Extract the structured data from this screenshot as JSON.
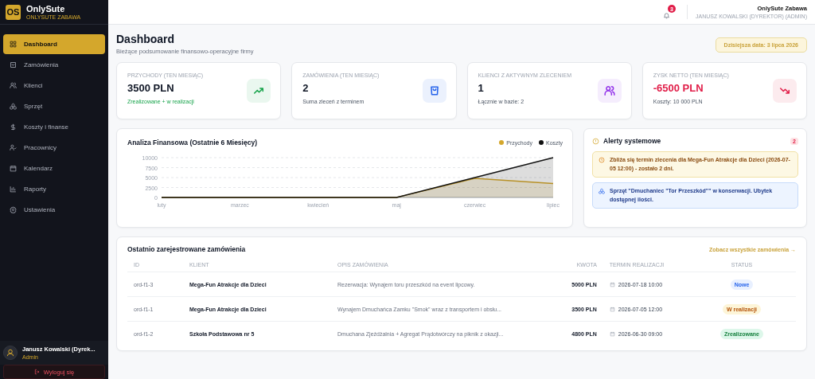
{
  "brand": {
    "logo": "OS",
    "name": "OnlySute",
    "subtitle": "ONLYSUTE ZABAWA"
  },
  "sidebar": {
    "items": [
      {
        "label": "Dashboard",
        "selected": true
      },
      {
        "label": "Zamówienia",
        "selected": false
      },
      {
        "label": "Klienci",
        "selected": false
      },
      {
        "label": "Sprzęt",
        "selected": false
      },
      {
        "label": "Koszty i finanse",
        "selected": false
      },
      {
        "label": "Pracownicy",
        "selected": false
      },
      {
        "label": "Kalendarz",
        "selected": false
      },
      {
        "label": "Raporty",
        "selected": false
      },
      {
        "label": "Ustawienia",
        "selected": false
      }
    ],
    "user": {
      "name": "Janusz Kowalski (Dyrek...",
      "role": "Admin"
    },
    "logout": "Wyloguj się"
  },
  "topbar": {
    "notifications": "3",
    "company": "OnlySute Zabawa",
    "user": "JANUSZ KOWALSKI (DYREKTOR) (ADMIN)"
  },
  "header": {
    "title": "Dashboard",
    "subtitle": "Bieżące podsumowanie finansowo-operacyjne firmy",
    "date": "Dzisiejsza data: 3 lipca 2026"
  },
  "stats": [
    {
      "kind": "revenue",
      "label": "PRZYCHODY (TEN MIESIĄC)",
      "value": "3500 PLN",
      "note": "Zrealizowane + w realizacji",
      "negative": false,
      "note_positive": true,
      "color": "#16a34a"
    },
    {
      "kind": "orders",
      "label": "ZAMÓWIENIA (TEN MIESIĄC)",
      "value": "2",
      "note": "Suma zleceń z terminem",
      "negative": false,
      "note_positive": false,
      "color": "#2563eb"
    },
    {
      "kind": "clients",
      "label": "KLIENCI Z AKTYWNYM ZLECENIEM",
      "value": "1",
      "note": "Łącznie w bazie: 2",
      "negative": false,
      "note_positive": false,
      "color": "#9333ea"
    },
    {
      "kind": "profit",
      "label": "ZYSK NETTO (TEN MIESIĄC)",
      "value": "-6500 PLN",
      "note": "Koszty: 10 000 PLN",
      "negative": true,
      "note_positive": false,
      "color": "#e11d48"
    }
  ],
  "chart": {
    "chart_data": {
      "type": "area",
      "title": "Analiza Finansowa (Ostatnie 6 Miesięcy)",
      "categories": [
        "luty",
        "marzec",
        "kwiecień",
        "maj",
        "czerwiec",
        "lipiec"
      ],
      "series": [
        {
          "name": "Przychody",
          "color": "#d4a72c",
          "values": [
            0,
            0,
            0,
            0,
            4800,
            3500
          ]
        },
        {
          "name": "Koszty",
          "color": "#111111",
          "values": [
            0,
            0,
            0,
            0,
            5000,
            10000
          ]
        }
      ],
      "ylim": [
        0,
        10000
      ],
      "grid": true,
      "yticks": [
        0,
        2500,
        5000,
        7500,
        10000
      ]
    }
  },
  "alerts": {
    "title": "Alerty systemowe",
    "count": "2",
    "items": [
      {
        "kind": "warning",
        "text": "Zbliża się termin zlecenia dla Mega-Fun Atrakcje dla Dzieci (2026-07-05 12:00) - zostało 2 dni."
      },
      {
        "kind": "info",
        "text": "Sprzęt \"Dmuchaniec \"Tor Przeszkód\"\" w konserwacji. Ubytek dostępnej ilości."
      }
    ]
  },
  "orders": {
    "title": "Ostatnio zarejestrowane zamówienia",
    "link": "Zobacz wszystkie zamówienia →",
    "columns": [
      "ID",
      "KLIENT",
      "OPIS ZAMÓWIENIA",
      "KWOTA",
      "TERMIN REALIZACJI",
      "STATUS"
    ],
    "rows": [
      {
        "id": "ord-f1-3",
        "client": "Mega-Fun Atrakcje dla Dzieci",
        "description": "Rezerwacja: Wynajem toru przeszkód na event lipcowy.",
        "amount": "5000 PLN",
        "due": "2026-07-18 10:00",
        "status": "Nowe",
        "kind": "new"
      },
      {
        "id": "ord-f1-1",
        "client": "Mega-Fun Atrakcje dla Dzieci",
        "description": "Wynajem Dmuchańca Zamku \"Smok\" wraz z transportem i obsłu...",
        "amount": "3500 PLN",
        "due": "2026-07-05 12:00",
        "status": "W realizacji",
        "kind": "progress"
      },
      {
        "id": "ord-f1-2",
        "client": "Szkoła Podstawowa nr 5",
        "description": "Dmuchana Zjeżdżalnia + Agregat Prądotwórczy na piknik z okazji...",
        "amount": "4800 PLN",
        "due": "2026-06-30 09:00",
        "status": "Zrealizowane",
        "kind": "done"
      }
    ]
  }
}
